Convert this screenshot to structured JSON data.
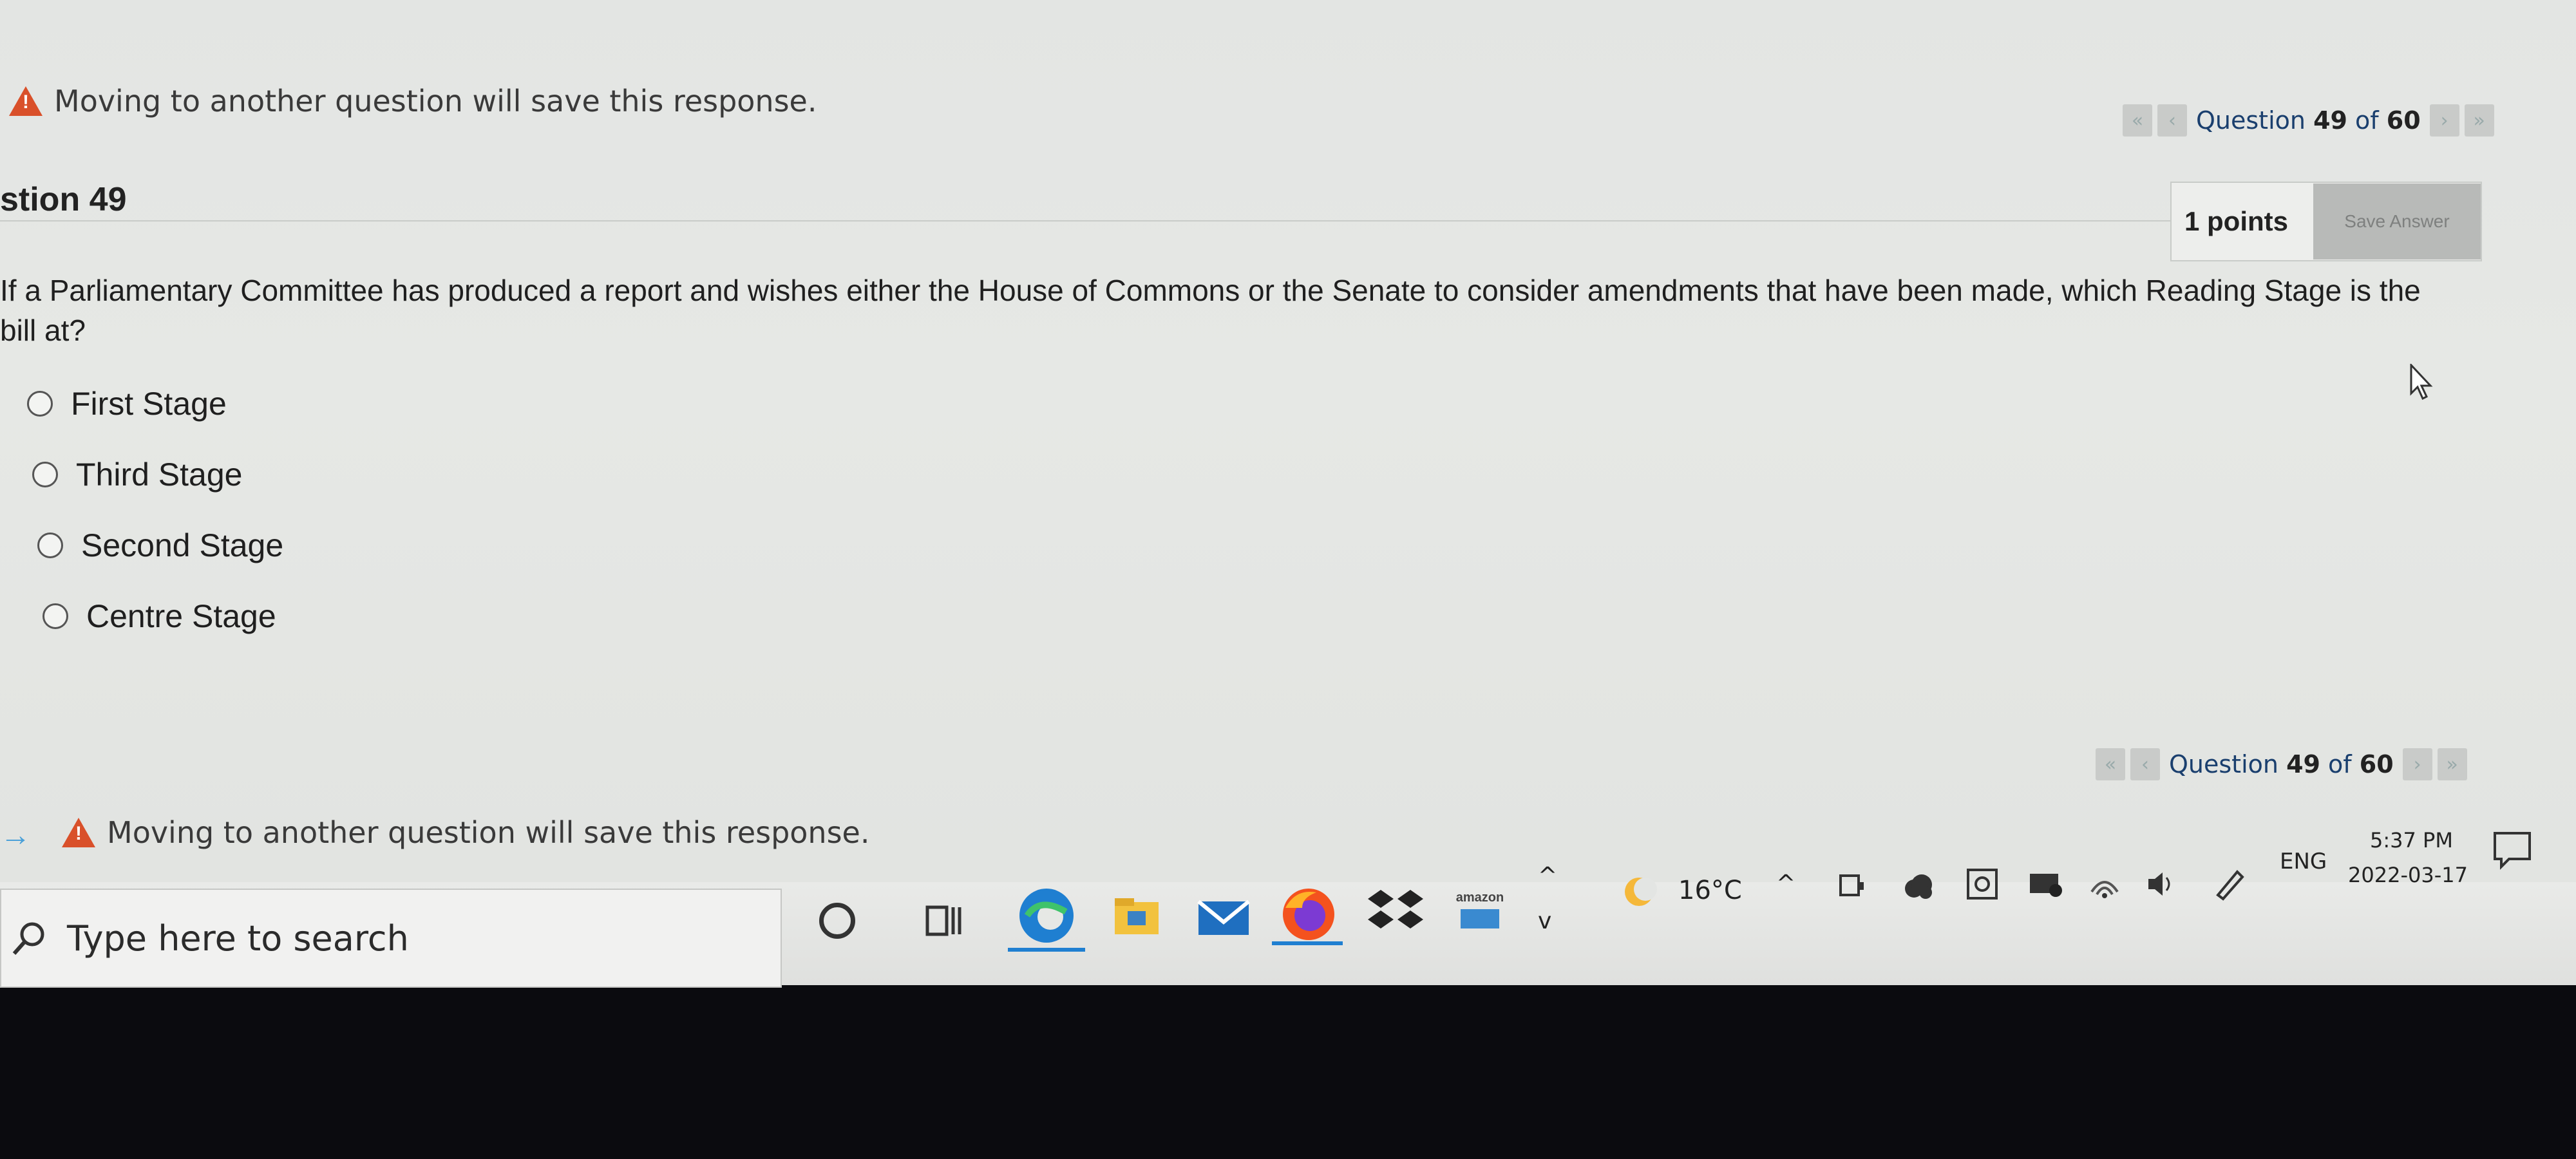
{
  "warning_text": "Moving to another question will save this response.",
  "nav_top": {
    "prefix": "Question",
    "current": "49",
    "sep": "of",
    "total": "60"
  },
  "nav_bottom": {
    "prefix": "Question",
    "current": "49",
    "sep": "of",
    "total": "60"
  },
  "question_title": "stion 49",
  "points_label": "1 points",
  "save_answer_label": "Save Answer",
  "question_text": "If a Parliamentary Committee has produced a report and wishes either the House of Commons or the Senate to consider amendments that have been made, which Reading Stage is the bill at?",
  "options": [
    {
      "label": "First Stage"
    },
    {
      "label": "Third Stage"
    },
    {
      "label": "Second Stage"
    },
    {
      "label": "Centre Stage"
    }
  ],
  "taskbar": {
    "search_placeholder": "Type here to search",
    "amazon_label": "amazon",
    "weather": "16°C",
    "language": "ENG",
    "time": "5:37 PM",
    "date": "2022-03-17"
  },
  "colors": {
    "warning": "#d9502a",
    "accent": "#1a3f6e",
    "edge_blue": "#1f7fd1",
    "firefox": "#f4521e"
  },
  "icons": [
    "warning-icon",
    "first-page-icon",
    "prev-page-icon",
    "next-page-icon",
    "last-page-icon",
    "search-icon",
    "cortana-icon",
    "task-view-icon",
    "edge-icon",
    "file-explorer-icon",
    "mail-icon",
    "firefox-icon",
    "dropbox-icon",
    "amazon-icon",
    "weather-icon",
    "chevron-up-icon",
    "meet-now-icon",
    "cloud-icon",
    "security-icon",
    "network-icon",
    "wifi-icon",
    "volume-icon",
    "pen-icon",
    "notification-icon"
  ]
}
